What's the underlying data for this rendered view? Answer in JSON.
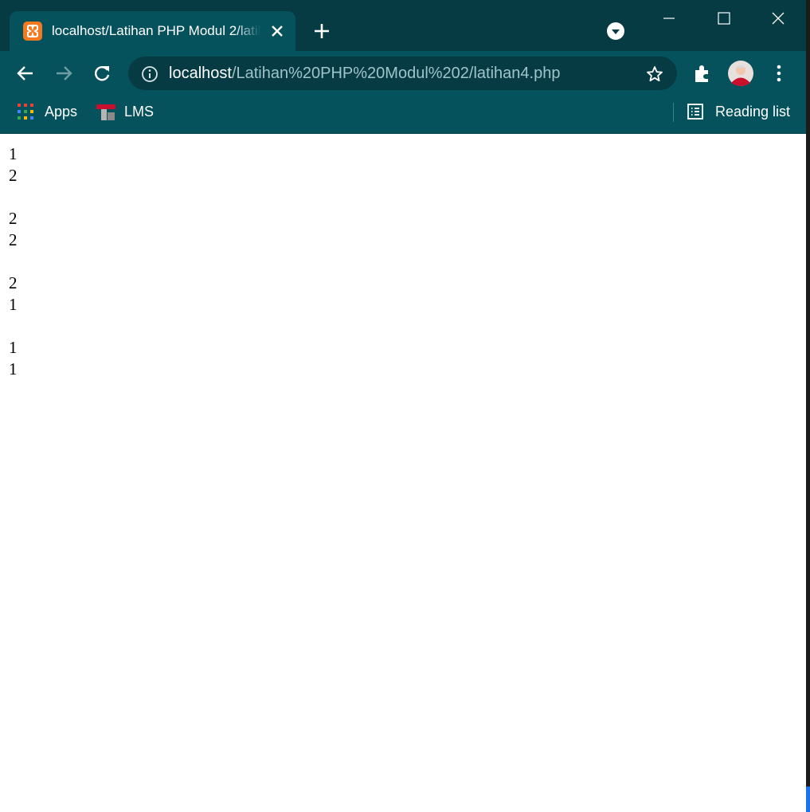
{
  "browser": {
    "tab": {
      "title": "localhost/Latihan PHP Modul 2/latihan4.php",
      "favicon": "xampp-icon"
    },
    "address_bar": {
      "host": "localhost",
      "path": "/Latihan%20PHP%20Modul%202/latihan4.php"
    },
    "bookmarks": [
      {
        "label": "Apps",
        "icon": "apps-grid-icon"
      },
      {
        "label": "LMS",
        "icon": "lms-icon"
      }
    ],
    "reading_list": {
      "label": "Reading list",
      "icon": "reading-list-icon"
    },
    "colors": {
      "frame": "#063b44",
      "toolbar": "#05525d",
      "favicon": "#f37a20"
    }
  },
  "page": {
    "groups": [
      [
        "1",
        "2"
      ],
      [
        "2",
        "2"
      ],
      [
        "2",
        "1"
      ],
      [
        "1",
        "1"
      ]
    ]
  }
}
